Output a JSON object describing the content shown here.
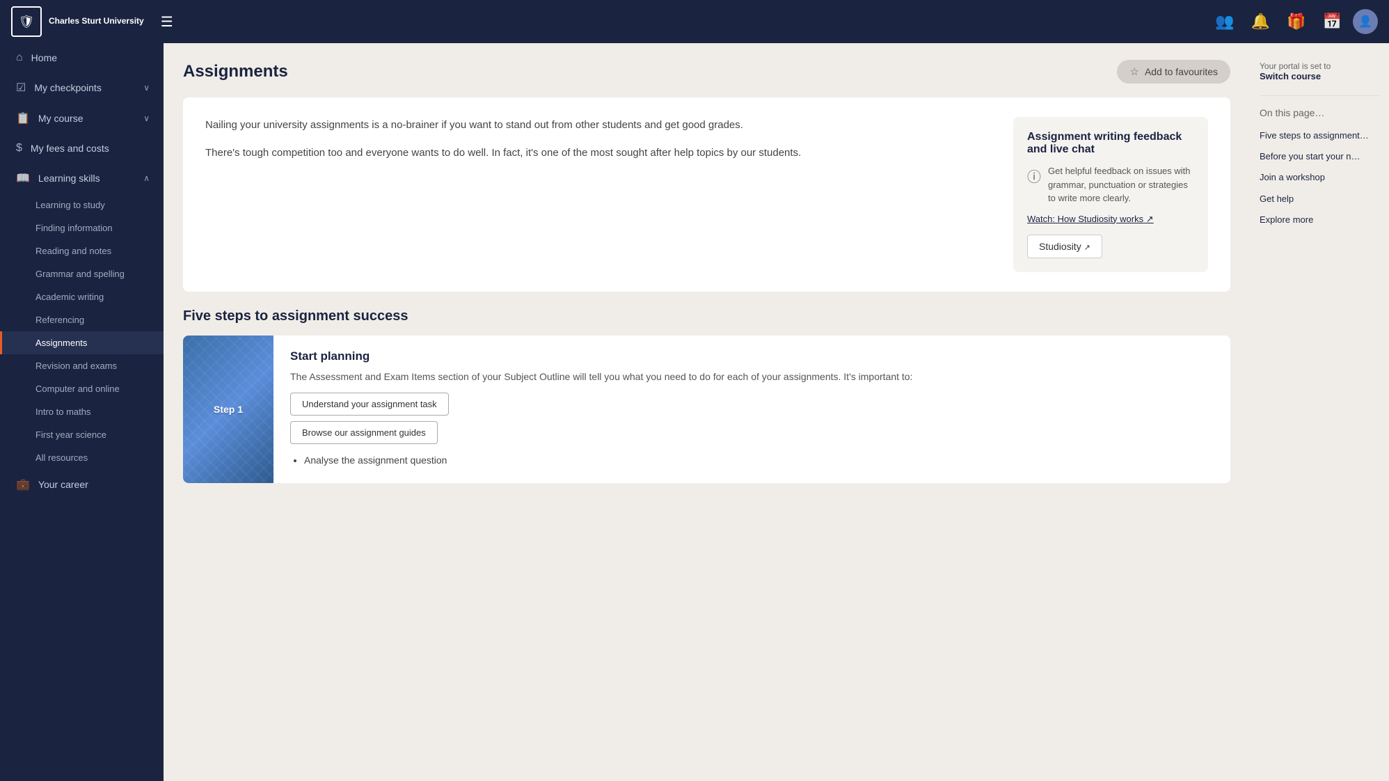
{
  "app": {
    "name": "Charles Sturt University",
    "logo_initial": "🛡"
  },
  "topnav": {
    "menu_label": "☰"
  },
  "portal_notice": {
    "prefix": "Your portal is set to",
    "action": "Switch course"
  },
  "sidebar": {
    "items": [
      {
        "id": "home",
        "label": "Home",
        "icon": "⌂",
        "type": "top"
      },
      {
        "id": "my-checkpoints",
        "label": "My checkpoints",
        "icon": "☑",
        "type": "top",
        "expanded": true
      },
      {
        "id": "my-course",
        "label": "My course",
        "icon": "📋",
        "type": "top",
        "expanded": true
      },
      {
        "id": "my-fees",
        "label": "My fees and costs",
        "icon": "$",
        "type": "top"
      },
      {
        "id": "learning-skills",
        "label": "Learning skills",
        "icon": "📖",
        "type": "top",
        "expanded": true
      }
    ],
    "sub_items": [
      {
        "id": "learning-to-study",
        "label": "Learning to study"
      },
      {
        "id": "finding-information",
        "label": "Finding information"
      },
      {
        "id": "reading-and-notes",
        "label": "Reading and notes"
      },
      {
        "id": "grammar-and-spelling",
        "label": "Grammar and spelling"
      },
      {
        "id": "academic-writing",
        "label": "Academic writing"
      },
      {
        "id": "referencing",
        "label": "Referencing"
      },
      {
        "id": "assignments",
        "label": "Assignments",
        "active": true
      },
      {
        "id": "revision-and-exams",
        "label": "Revision and exams"
      },
      {
        "id": "computer-and-online",
        "label": "Computer and online"
      },
      {
        "id": "intro-to-maths",
        "label": "Intro to maths"
      },
      {
        "id": "first-year-science",
        "label": "First year science"
      },
      {
        "id": "all-resources",
        "label": "All resources"
      }
    ],
    "bottom_items": [
      {
        "id": "your-career",
        "label": "Your career",
        "icon": "💼"
      }
    ]
  },
  "page": {
    "title": "Assignments",
    "add_favourites_label": "Add to favourites"
  },
  "intro": {
    "para1": "Nailing your university assignments is a no-brainer if you want to stand out from other students and get good grades.",
    "para2": "There's tough competition too and everyone wants to do well. In fact, it's one of the most sought after help topics by our students."
  },
  "sidebar_card": {
    "title": "Assignment writing feedback and live chat",
    "description": "Get helpful feedback on issues with grammar, punctuation or strategies to write more clearly.",
    "watch_link": "Watch: How Studiosity works",
    "button_label": "Studiosity"
  },
  "right_sidebar": {
    "title": "On this page…",
    "links": [
      "Five steps to assignment…",
      "Before you start your n…",
      "Join a workshop",
      "Get help",
      "Explore more"
    ]
  },
  "section1": {
    "title": "Five steps to assignment success",
    "step": {
      "label": "Step 1",
      "heading": "Start planning",
      "description": "The Assessment and Exam Items section of your Subject Outline will tell you what you need to do for each of your assignments. It's important to:",
      "btn1": "Understand your assignment task",
      "btn2": "Browse our assignment guides",
      "bullets": [
        "Analyse the assignment question"
      ]
    }
  }
}
